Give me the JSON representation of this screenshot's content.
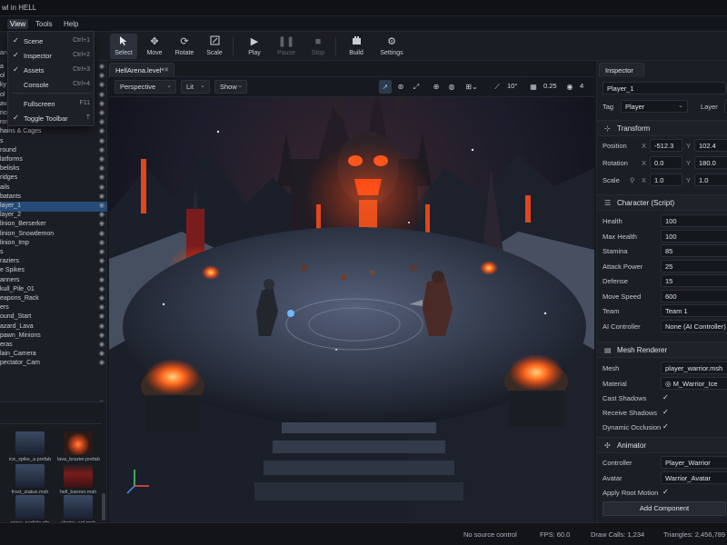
{
  "window": {
    "title": "wl in HELL"
  },
  "menubar": {
    "items": [
      {
        "label": "View"
      },
      {
        "label": "Tools"
      },
      {
        "label": "Help"
      }
    ]
  },
  "toolbar": {
    "tools": [
      {
        "label": "Select",
        "icon": "pointer-icon"
      },
      {
        "label": "Move",
        "icon": "move-icon"
      },
      {
        "label": "Rotate",
        "icon": "rotate-icon"
      },
      {
        "label": "Scale",
        "icon": "scale-icon"
      },
      {
        "label": "Play",
        "icon": "play-icon"
      },
      {
        "label": "Pause",
        "icon": "pause-icon"
      },
      {
        "label": "Stop",
        "icon": "stop-icon"
      },
      {
        "label": "Build",
        "icon": "build-icon"
      },
      {
        "label": "Settings",
        "icon": "gear-icon"
      }
    ],
    "edge_label": "an"
  },
  "view_menu": {
    "items": [
      {
        "label": "Scene",
        "shortcut": "Ctrl+1",
        "checked": true
      },
      {
        "label": "Inspector",
        "shortcut": "Ctrl+2",
        "checked": true
      },
      {
        "label": "Assets",
        "shortcut": "Ctrl+3",
        "checked": true
      },
      {
        "label": "Console",
        "shortcut": "Ctrl+4",
        "checked": false
      },
      {
        "label": "Fullscreen",
        "shortcut": "F11",
        "checked": false
      },
      {
        "label": "Toggle Toolbar",
        "shortcut": "T",
        "checked": true
      }
    ]
  },
  "hierarchy": {
    "items": [
      {
        "name": "a"
      },
      {
        "name": "ol"
      },
      {
        "name": "ky"
      },
      {
        "name": "ol"
      },
      {
        "name": "ava Falls"
      },
      {
        "name": "now & Particles"
      },
      {
        "name": "rosted Statues"
      },
      {
        "name": "hains & Cages"
      },
      {
        "name": "s"
      },
      {
        "name": "round"
      },
      {
        "name": "latforms"
      },
      {
        "name": "belisks"
      },
      {
        "name": "ridges"
      },
      {
        "name": "ails"
      },
      {
        "name": "batants"
      },
      {
        "name": "layer_1",
        "selected": true
      },
      {
        "name": "layer_2"
      },
      {
        "name": "linion_Berserker"
      },
      {
        "name": "linion_Snowdemon"
      },
      {
        "name": "linion_Imp"
      },
      {
        "name": "s"
      },
      {
        "name": "raziers"
      },
      {
        "name": "e Spikes"
      },
      {
        "name": "anners"
      },
      {
        "name": "kull_Pile_01"
      },
      {
        "name": "eapons_Rack"
      },
      {
        "name": "ers"
      },
      {
        "name": "ound_Start"
      },
      {
        "name": "azard_Lava"
      },
      {
        "name": "pawn_Minions"
      },
      {
        "name": "eras"
      },
      {
        "name": "lain_Camera"
      },
      {
        "name": "pectator_Cam"
      }
    ]
  },
  "assets": {
    "items": [
      {
        "name": "ice_spike_a.prefab",
        "kind": "ice"
      },
      {
        "name": "lava_brazier.prefab",
        "kind": "fire"
      },
      {
        "name": "frost_statue.msh",
        "kind": "ice"
      },
      {
        "name": "hell_banner.msh",
        "kind": "red"
      },
      {
        "name": "snow_particle.pfx",
        "kind": "ice"
      },
      {
        "name": "chains_set.msh",
        "kind": "ice"
      }
    ]
  },
  "viewport": {
    "tab_label": "HellArena.level*",
    "camera_mode": "Perspective",
    "shading": "Lit",
    "show_label": "Show",
    "angle_snap": "10°",
    "grid_size": "0.25",
    "scale_value": "4",
    "colors": {
      "sky": "#141826",
      "lava": "#e0461c",
      "snow": "#9aa4b8"
    }
  },
  "inspector": {
    "tab_label": "Inspector",
    "object_name": "Player_1",
    "tag_label": "Tag",
    "tag_value": "Player",
    "layer_label": "Layer",
    "transform": {
      "title": "Transform",
      "position_label": "Position",
      "position": {
        "x": "-512.3",
        "y": "102.4"
      },
      "rotation_label": "Rotation",
      "rotation": {
        "x": "0.0",
        "y": "180.0"
      },
      "scale_label": "Scale",
      "scale": {
        "x": "1.0",
        "y": "1.0"
      }
    },
    "character": {
      "title": "Character (Script)",
      "props": [
        {
          "label": "Health",
          "value": "100"
        },
        {
          "label": "Max Health",
          "value": "100"
        },
        {
          "label": "Stamina",
          "value": "85"
        },
        {
          "label": "Attack Power",
          "value": "25"
        },
        {
          "label": "Defense",
          "value": "15"
        },
        {
          "label": "Move Speed",
          "value": "600"
        },
        {
          "label": "Team",
          "value": "Team 1"
        },
        {
          "label": "AI Controller",
          "value": "None (AI Controller)"
        }
      ]
    },
    "mesh_renderer": {
      "title": "Mesh Renderer",
      "mesh_label": "Mesh",
      "mesh_value": "player_warrior.msh",
      "material_label": "Material",
      "material_value": "◎ M_Warrior_Ice",
      "flags": [
        {
          "label": "Cast Shadows",
          "checked": true
        },
        {
          "label": "Receive Shadows",
          "checked": true
        },
        {
          "label": "Dynamic Occlusion",
          "checked": true
        }
      ]
    },
    "animator": {
      "title": "Animator",
      "controller_label": "Controller",
      "controller_value": "Player_Warrior",
      "avatar_label": "Avatar",
      "avatar_value": "Warrior_Avatar",
      "root_motion_label": "Apply Root Motion",
      "root_motion": true
    },
    "add_component_label": "Add Component"
  },
  "statusbar": {
    "source_control": "No source control",
    "fps": "FPS: 60.0",
    "draw_calls": "Draw Calls: 1,234",
    "triangles": "Triangles: 2,456,789"
  }
}
